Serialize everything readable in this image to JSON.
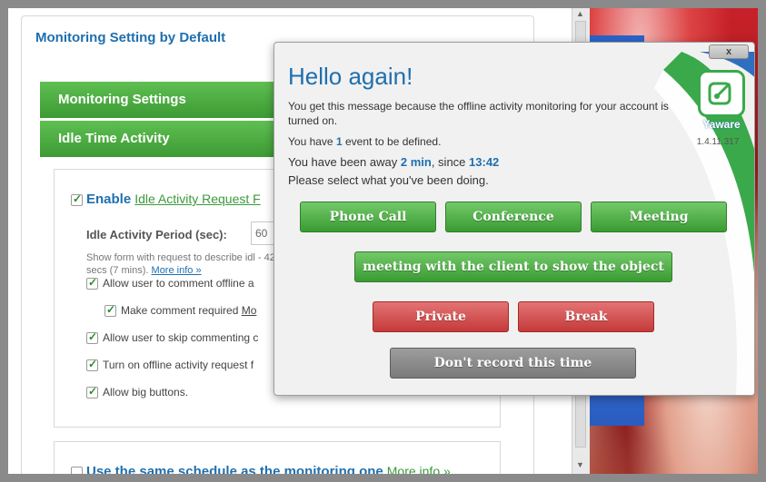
{
  "settings": {
    "card_title": "Monitoring Setting by Default",
    "section_monitoring": "Monitoring Settings",
    "section_idle": "Idle Time Activity",
    "enable_label": "Enable",
    "enable_link": "Idle Activity Request F",
    "period_label": "Idle Activity Period (sec):",
    "period_value": "60",
    "hint_text": "Show form with request to describe idl - 420 secs (7 mins).",
    "hint_more": "More info »",
    "opt_comment": "Allow user to comment offline a",
    "opt_required": "Make comment required",
    "opt_required_more": "Mo",
    "opt_skip": "Allow user to skip commenting c",
    "opt_turn_on": "Turn on offline activity request f",
    "opt_big": "Allow big buttons.",
    "same_schedule": "Use the same schedule as the monitoring one",
    "same_more": "More info »"
  },
  "popup": {
    "close_label": "x",
    "app_name": "Yaware",
    "version": "1.4.11.317",
    "title": "Hello again!",
    "message": "You get this message because the offline activity monitoring for your account is turned on.",
    "events_prefix": "You have",
    "events_count": "1",
    "events_suffix": "event to be defined.",
    "away_prefix": "You have been away",
    "away_duration": "2 min",
    "away_mid": ", since",
    "away_since": "13:42",
    "select_prompt": "Please select what you've been doing.",
    "buttons": {
      "phone_call": "Phone Call",
      "conference": "Conference",
      "meeting": "Meeting",
      "meeting_client": "meeting with the client to show the object",
      "private": "Private",
      "break": "Break",
      "dont_record": "Don't record this time"
    }
  },
  "colors": {
    "green_button": "#3a9b32",
    "red_button": "#c53a3a",
    "grey_button": "#7a7a7a",
    "title_blue": "#1f6fae"
  }
}
